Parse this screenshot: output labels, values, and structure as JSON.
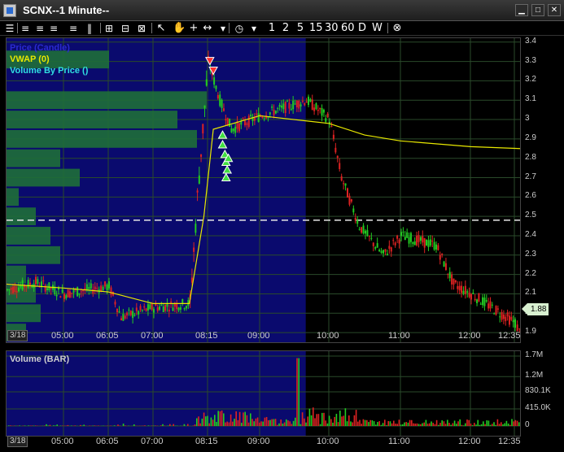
{
  "window": {
    "title": "SCNX--1 Minute--",
    "buttons": [
      "▁",
      "□",
      "✕"
    ]
  },
  "toolbar": {
    "intervals": [
      "1",
      "2",
      "5",
      "15",
      "30",
      "60",
      "D",
      "W"
    ],
    "icons": [
      "chart-layout-icon",
      "list-icon",
      "pause-icon",
      "grid-icon",
      "expand-icon",
      "zoom-icon",
      "pointer-icon",
      "hand-icon",
      "crosshair-icon",
      "range-icon",
      "clock-icon",
      "dropdown-icon",
      "close-icon"
    ]
  },
  "price_pane": {
    "legend": [
      {
        "label": "Price (Candle)",
        "color": "#2a2ad0"
      },
      {
        "label": "VWAP (0)",
        "color": "#e8e800"
      },
      {
        "label": "Volume By Price ()",
        "color": "#30e0e0"
      }
    ],
    "y_ticks": [
      "3.4",
      "3.3",
      "3.2",
      "3.1",
      "3",
      "2.9",
      "2.8",
      "2.7",
      "2.6",
      "2.5",
      "2.4",
      "2.3",
      "2.2",
      "2.1",
      "2",
      "1.9"
    ],
    "last_price": "1.88",
    "date_label": "3/18",
    "x_ticks": [
      "05:00",
      "06:05",
      "07:00",
      "08:15",
      "09:00",
      "10:00",
      "11:00",
      "12:00",
      "12:35"
    ]
  },
  "volume_pane": {
    "legend": "Volume (BAR)",
    "y_ticks": [
      "1.7M",
      "1.2M",
      "830.1K",
      "415.0K",
      "0"
    ],
    "date_label": "3/18",
    "x_ticks": [
      "05:00",
      "06:05",
      "07:00",
      "08:15",
      "09:00",
      "10:00",
      "11:00",
      "12:00",
      "12:35"
    ]
  },
  "colors": {
    "premarket_bg": "#0a0a6e",
    "up": "#22cc22",
    "down": "#dd2222",
    "vwap": "#e8e800",
    "vbp": "#1e6e38",
    "grid": "#2a4a2a"
  },
  "chart_data": {
    "type": "candlestick",
    "ylim": [
      1.85,
      3.42
    ],
    "x_ticks": [
      "05:00",
      "06:05",
      "07:00",
      "08:15",
      "09:00",
      "10:00",
      "11:00",
      "12:00",
      "12:35"
    ],
    "price_path": [
      {
        "t": "04:00",
        "p": 2.12
      },
      {
        "t": "04:30",
        "p": 2.16
      },
      {
        "t": "05:00",
        "p": 2.1
      },
      {
        "t": "05:30",
        "p": 2.12
      },
      {
        "t": "06:05",
        "p": 2.14
      },
      {
        "t": "06:20",
        "p": 1.98
      },
      {
        "t": "07:00",
        "p": 2.03
      },
      {
        "t": "07:50",
        "p": 2.05
      },
      {
        "t": "08:00",
        "p": 2.6
      },
      {
        "t": "08:15",
        "p": 3.3
      },
      {
        "t": "08:25",
        "p": 3.1
      },
      {
        "t": "08:35",
        "p": 2.95
      },
      {
        "t": "09:00",
        "p": 3.02
      },
      {
        "t": "09:40",
        "p": 3.1
      },
      {
        "t": "10:00",
        "p": 3.0
      },
      {
        "t": "10:10",
        "p": 2.7
      },
      {
        "t": "10:25",
        "p": 2.45
      },
      {
        "t": "10:45",
        "p": 2.3
      },
      {
        "t": "11:00",
        "p": 2.4
      },
      {
        "t": "11:30",
        "p": 2.35
      },
      {
        "t": "11:45",
        "p": 2.15
      },
      {
        "t": "12:00",
        "p": 2.1
      },
      {
        "t": "12:35",
        "p": 1.95
      },
      {
        "t": "12:45",
        "p": 1.88
      }
    ],
    "vwap": [
      {
        "t": "04:00",
        "p": 2.15
      },
      {
        "t": "05:00",
        "p": 2.13
      },
      {
        "t": "06:05",
        "p": 2.11
      },
      {
        "t": "07:00",
        "p": 2.05
      },
      {
        "t": "07:50",
        "p": 2.05
      },
      {
        "t": "08:10",
        "p": 2.5
      },
      {
        "t": "08:20",
        "p": 2.95
      },
      {
        "t": "09:00",
        "p": 3.02
      },
      {
        "t": "10:00",
        "p": 2.98
      },
      {
        "t": "10:30",
        "p": 2.92
      },
      {
        "t": "11:00",
        "p": 2.89
      },
      {
        "t": "12:00",
        "p": 2.86
      },
      {
        "t": "12:45",
        "p": 2.85
      }
    ],
    "reference_line": 2.48,
    "volume_by_price": [
      {
        "price": 3.31,
        "relative": 0.42
      },
      {
        "price": 3.1,
        "relative": 0.82
      },
      {
        "price": 3.0,
        "relative": 0.7
      },
      {
        "price": 2.9,
        "relative": 0.78
      },
      {
        "price": 2.8,
        "relative": 0.22
      },
      {
        "price": 2.7,
        "relative": 0.3
      },
      {
        "price": 2.6,
        "relative": 0.05
      },
      {
        "price": 2.5,
        "relative": 0.12
      },
      {
        "price": 2.4,
        "relative": 0.18
      },
      {
        "price": 2.3,
        "relative": 0.22
      },
      {
        "price": 2.2,
        "relative": 0.08
      },
      {
        "price": 2.1,
        "relative": 0.12
      },
      {
        "price": 2.0,
        "relative": 0.14
      },
      {
        "price": 1.9,
        "relative": 0.08
      }
    ],
    "volume_ylim": [
      0,
      1700000
    ]
  }
}
